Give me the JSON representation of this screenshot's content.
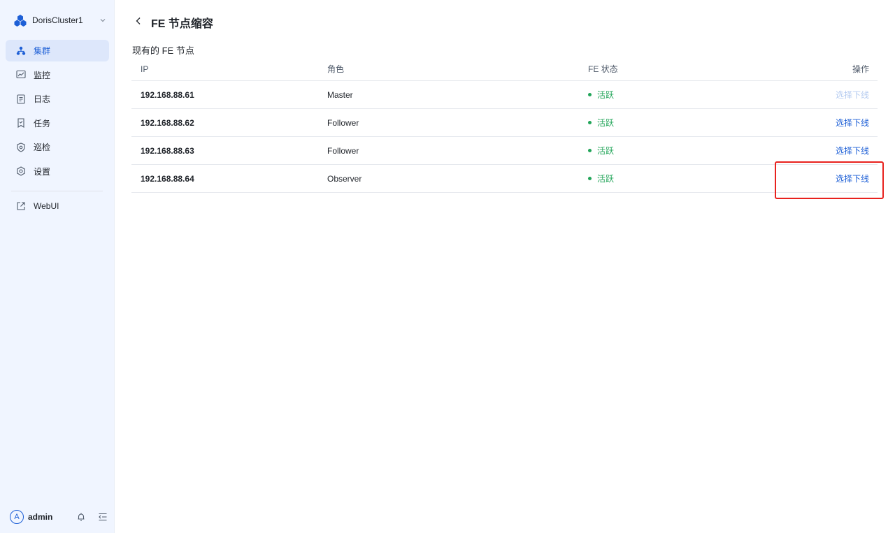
{
  "sidebar": {
    "cluster_name": "DorisCluster1",
    "items": [
      {
        "label": "集群",
        "icon": "cluster-icon",
        "active": true
      },
      {
        "label": "监控",
        "icon": "monitor-icon",
        "active": false
      },
      {
        "label": "日志",
        "icon": "log-icon",
        "active": false
      },
      {
        "label": "任务",
        "icon": "task-icon",
        "active": false
      },
      {
        "label": "巡检",
        "icon": "inspect-icon",
        "active": false
      },
      {
        "label": "设置",
        "icon": "gear-icon",
        "active": false
      }
    ],
    "webui_label": "WebUI",
    "user": {
      "avatar_letter": "A",
      "name": "admin"
    }
  },
  "header": {
    "title": "FE 节点缩容"
  },
  "section": {
    "title": "现有的 FE 节点"
  },
  "table": {
    "columns": {
      "ip": "IP",
      "role": "角色",
      "status": "FE 状态",
      "action": "操作"
    },
    "rows": [
      {
        "ip": "192.168.88.61",
        "role": "Master",
        "status": "活跃",
        "action": "选择下线",
        "action_enabled": false
      },
      {
        "ip": "192.168.88.62",
        "role": "Follower",
        "status": "活跃",
        "action": "选择下线",
        "action_enabled": true
      },
      {
        "ip": "192.168.88.63",
        "role": "Follower",
        "status": "活跃",
        "action": "选择下线",
        "action_enabled": true
      },
      {
        "ip": "192.168.88.64",
        "role": "Observer",
        "status": "活跃",
        "action": "选择下线",
        "action_enabled": true
      }
    ]
  },
  "colors": {
    "accent": "#1d5fd6",
    "status_active": "#22a559",
    "sidebar_bg": "#f0f5ff",
    "highlight": "#e8221e"
  }
}
